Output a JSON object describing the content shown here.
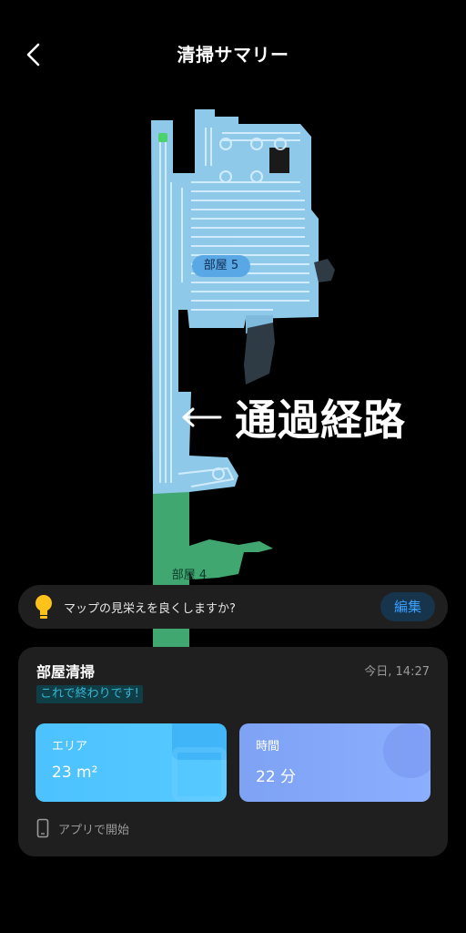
{
  "header": {
    "title": "清掃サマリー",
    "back_icon": "chevron-left-icon"
  },
  "map": {
    "room5_label": "部屋 5",
    "room4_label": "部屋 4",
    "annotation_text": "通過経路",
    "colors": {
      "room5": "#8ec9ea",
      "room5_path": "#d8f0ff",
      "room4": "#3fa76f",
      "obstacle": "#2e3a44"
    }
  },
  "tip": {
    "text": "マップの見栄えを良くしますか?",
    "edit_label": "編集",
    "icon": "lightbulb-icon"
  },
  "summary": {
    "title": "部屋清掃",
    "time": "今日, 14:27",
    "badge": "これで終わりです!",
    "stats": [
      {
        "label": "エリア",
        "value": "23 m²"
      },
      {
        "label": "時間",
        "value": "22 分"
      }
    ],
    "app_start": "アプリで開始",
    "app_icon": "phone-icon"
  }
}
